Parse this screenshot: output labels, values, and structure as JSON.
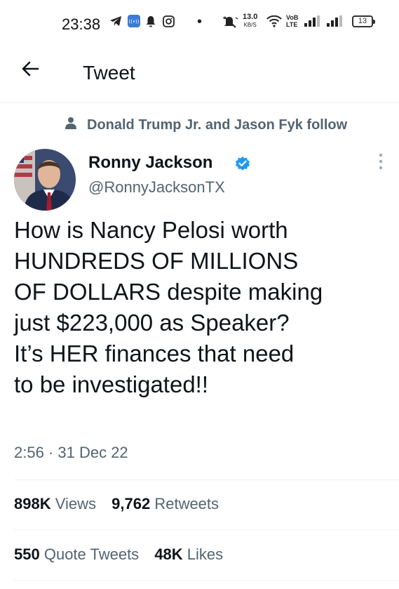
{
  "status_bar": {
    "time": "23:38",
    "net_speed_value": "13.0",
    "net_speed_unit": "KB/S",
    "volte_line1": "VoB",
    "volte_line2": "LTE",
    "battery": "13"
  },
  "header": {
    "back_icon": "arrow-left-icon",
    "title": "Tweet"
  },
  "social_context": {
    "icon": "person-icon",
    "text": "Donald Trump Jr. and Jason Fyk follow"
  },
  "author": {
    "name": "Ronny Jackson",
    "handle": "@RonnyJacksonTX",
    "verified_color": "#1d9bf0"
  },
  "tweet": {
    "lines": [
      "How is Nancy Pelosi worth",
      "HUNDREDS OF MILLIONS",
      "OF DOLLARS despite making",
      "just $223,000 as Speaker?",
      "It’s HER finances that need",
      "to be investigated!!"
    ],
    "timestamp": "2:56 · 31 Dec 22"
  },
  "stats": {
    "views_count": "898K",
    "views_label": "Views",
    "retweets_count": "9,762",
    "retweets_label": "Retweets",
    "quote_count": "550",
    "quote_label": "Quote Tweets",
    "likes_count": "48K",
    "likes_label": "Likes"
  }
}
